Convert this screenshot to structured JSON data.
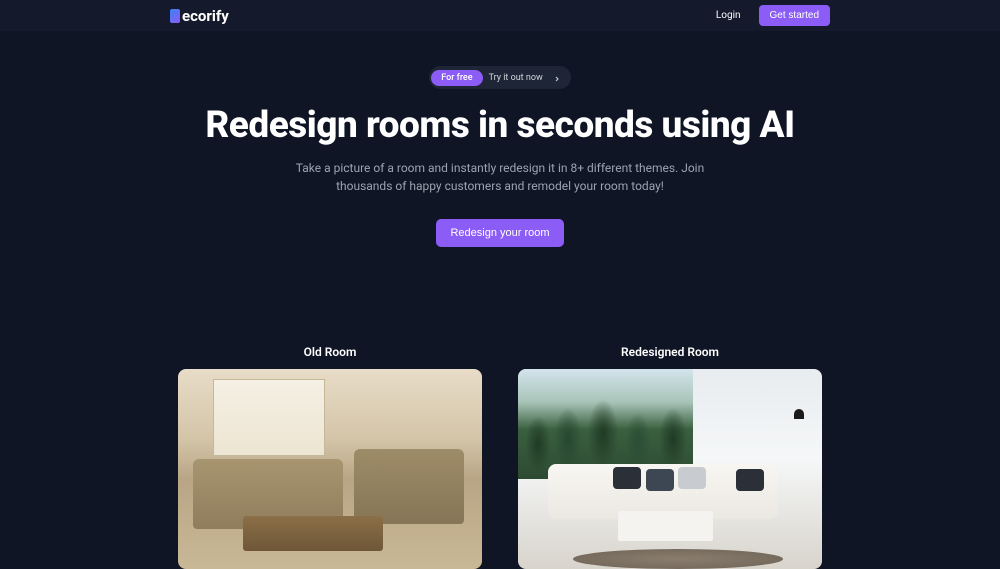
{
  "header": {
    "brand": "ecorify",
    "login": "Login",
    "cta": "Get started"
  },
  "hero": {
    "pill_badge": "For free",
    "pill_text": "Try it out now",
    "headline": "Redesign rooms in seconds using AI",
    "subhead": "Take a picture of a room and instantly redesign it in 8+ different themes. Join thousands of happy customers and remodel your room today!",
    "cta": "Redesign your room"
  },
  "compare": {
    "old_label": "Old Room",
    "new_label": "Redesigned Room"
  }
}
